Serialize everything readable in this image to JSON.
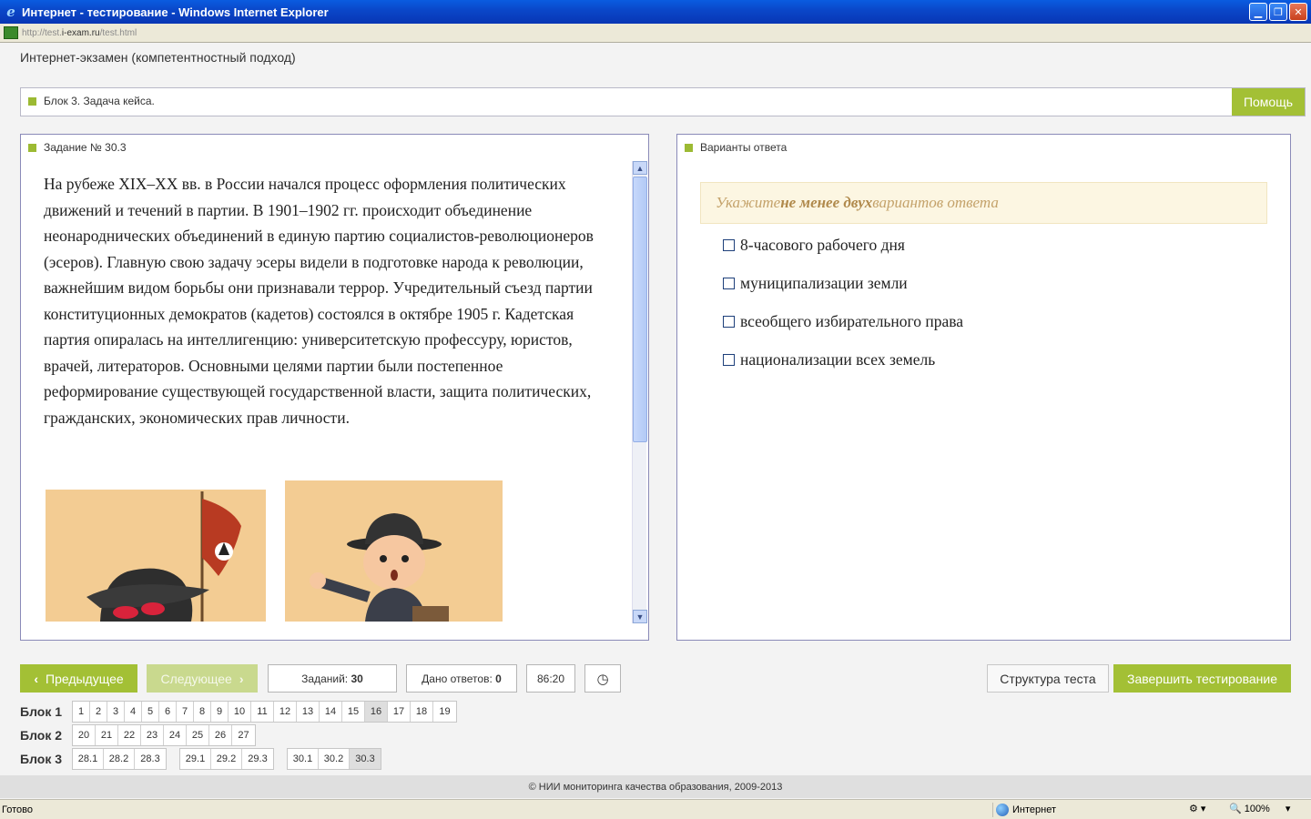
{
  "window": {
    "title": "Интернет - тестирование - Windows Internet Explorer",
    "url_prefix": "http://test.",
    "url_domain": "i-exam.ru",
    "url_suffix": "/test.html"
  },
  "page": {
    "title": "Интернет-экзамен (компетентностный подход)",
    "block_label": "Блок 3. Задача кейса.",
    "help_label": "Помощь"
  },
  "task": {
    "heading": "Задание № 30.3",
    "text": "На рубеже XIX–XX вв. в России начался процесс оформления политических движений и течений в партии. В 1901–1902 гг. происходит объединение неонароднических объединений в единую партию социалистов-революционеров (эсеров). Главную свою задачу эсеры видели в подготовке народа к революции, важнейшим видом борьбы они признавали террор. Учредительный съезд партии конституционных демократов (кадетов) состоялся в октябре 1905 г. Кадетская партия опиралась на интеллигенцию: университетскую профессуру, юристов, врачей, литераторов. Основными целями партии были постепенное реформирование существующей государственной власти, защита политических, гражданских, экономических прав личности."
  },
  "answers": {
    "heading": "Варианты ответа",
    "hint_before": "Укажите ",
    "hint_bold": "не менее двух",
    "hint_after": " вариантов ответа",
    "options": [
      "8-часового рабочего дня",
      "муниципализации земли",
      "всеобщего избирательного права",
      "национализации всех земель"
    ]
  },
  "nav": {
    "prev_label": "Предыдущее",
    "next_label": "Следующее",
    "tasks_label": "Заданий:",
    "tasks_value": "30",
    "answered_label": "Дано ответов:",
    "answered_value": "0",
    "time": "86:20",
    "structure_label": "Структура теста",
    "finish_label": "Завершить тестирование"
  },
  "blocks": {
    "block1_label": "Блок 1",
    "block1": [
      "1",
      "2",
      "3",
      "4",
      "5",
      "6",
      "7",
      "8",
      "9",
      "10",
      "11",
      "12",
      "13",
      "14",
      "15",
      "16",
      "17",
      "18",
      "19"
    ],
    "block2_label": "Блок 2",
    "block2": [
      "20",
      "21",
      "22",
      "23",
      "24",
      "25",
      "26",
      "27"
    ],
    "block3_label": "Блок 3",
    "block3_groups": [
      [
        "28.1",
        "28.2",
        "28.3"
      ],
      [
        "29.1",
        "29.2",
        "29.3"
      ],
      [
        "30.1",
        "30.2",
        "30.3"
      ]
    ]
  },
  "footer": "© НИИ мониторинга качества образования, 2009-2013",
  "status": {
    "ready": "Готово",
    "zone": "Интернет",
    "zoom": "100%"
  },
  "colors": {
    "accent_green": "#a3c035",
    "panel_border": "#8a8ab8",
    "hint_bg": "#fcf6e2",
    "titlebar_blue": "#0a46c8"
  }
}
